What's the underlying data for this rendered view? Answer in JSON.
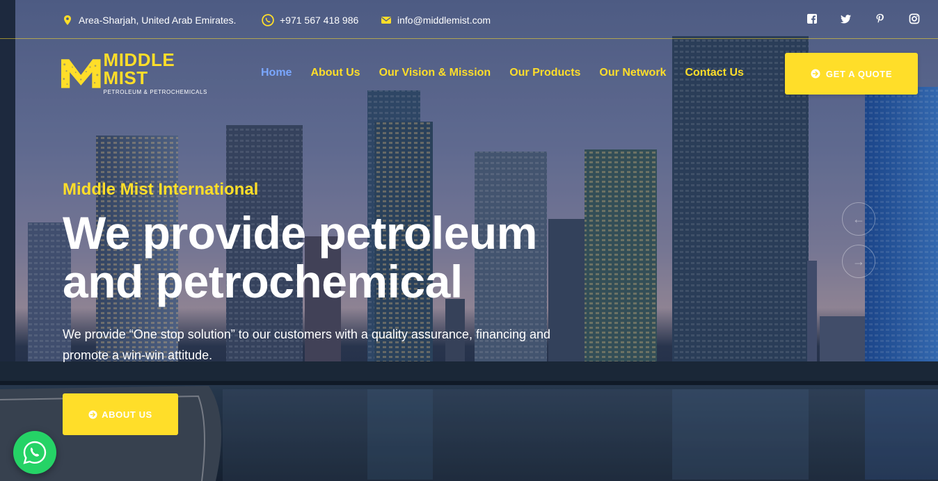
{
  "topbar": {
    "location": "Area-Sharjah, United Arab Emirates.",
    "phone": "+971 567 418 986",
    "email": "info@middlemist.com",
    "icons": {
      "location": "map-pin-icon",
      "phone": "whatsapp-icon",
      "email": "envelope-icon"
    },
    "socials": [
      {
        "name": "facebook-icon"
      },
      {
        "name": "twitter-icon"
      },
      {
        "name": "pinterest-icon"
      },
      {
        "name": "instagram-icon"
      }
    ]
  },
  "logo": {
    "name": "MIDDLE MIST",
    "tagline": "PETROLEUM & PETROCHEMICALS"
  },
  "nav": {
    "items": [
      {
        "label": "Home",
        "active": true
      },
      {
        "label": "About Us"
      },
      {
        "label": "Our Vision & Mission"
      },
      {
        "label": "Our Products"
      },
      {
        "label": "Our Network"
      },
      {
        "label": "Contact Us"
      }
    ],
    "quote_button": "GET A QUOTE"
  },
  "hero": {
    "eyebrow": "Middle Mist International",
    "headline": "We provide petroleum and petrochemical",
    "lead": "We provide “One stop solution” to our customers with a quality assurance, financing and promote a win-win attitude.",
    "about_button": "ABOUT US",
    "prev_arrow": "←",
    "next_arrow": "→"
  },
  "colors": {
    "accent": "#ffde29",
    "active_nav": "#7aa7ff",
    "whatsapp": "#25d366"
  }
}
